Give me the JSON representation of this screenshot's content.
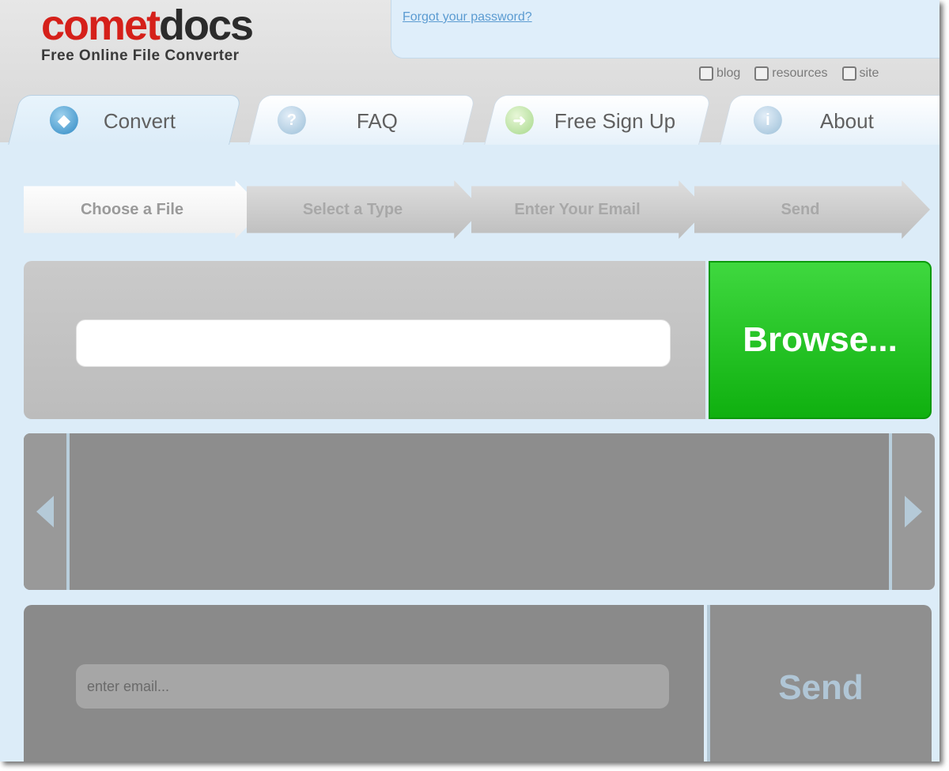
{
  "brand": {
    "name_part1": "comet",
    "name_part2": "docs",
    "tagline": "Free Online File Converter"
  },
  "login": {
    "forgot_password": "Forgot your password?"
  },
  "util_links": [
    {
      "label": "blog",
      "icon": "chat-bubble-icon"
    },
    {
      "label": "resources",
      "icon": "floppy-disk-icon"
    },
    {
      "label": "site",
      "icon": "sitemap-icon"
    }
  ],
  "tabs": [
    {
      "label": "Convert",
      "icon": "convert-icon",
      "active": true
    },
    {
      "label": "FAQ",
      "icon": "question-icon",
      "active": false
    },
    {
      "label": "Free Sign Up",
      "icon": "signup-arrow-icon",
      "active": false
    },
    {
      "label": "About",
      "icon": "info-icon",
      "active": false
    }
  ],
  "steps": [
    {
      "label": "Choose a File",
      "active": true
    },
    {
      "label": "Select a Type",
      "active": false
    },
    {
      "label": "Enter Your Email",
      "active": false
    },
    {
      "label": "Send",
      "active": false
    }
  ],
  "file": {
    "value": "",
    "browse_label": "Browse..."
  },
  "email": {
    "placeholder": "enter email...",
    "send_label": "Send"
  },
  "colors": {
    "brand_red": "#d5201a",
    "browse_green": "#1fc01f",
    "page_bg": "#dcecf8"
  }
}
